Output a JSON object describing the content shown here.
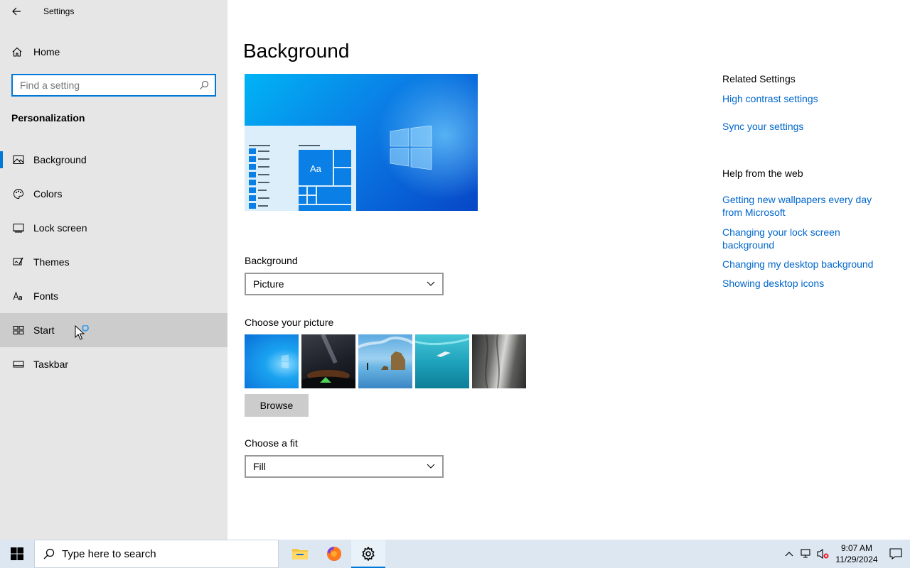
{
  "window": {
    "title": "Settings"
  },
  "sidebar": {
    "home_label": "Home",
    "search_placeholder": "Find a setting",
    "section_title": "Personalization",
    "items": [
      {
        "label": "Background",
        "icon": "picture-icon"
      },
      {
        "label": "Colors",
        "icon": "palette-icon"
      },
      {
        "label": "Lock screen",
        "icon": "lock-screen-icon"
      },
      {
        "label": "Themes",
        "icon": "themes-icon"
      },
      {
        "label": "Fonts",
        "icon": "fonts-icon"
      },
      {
        "label": "Start",
        "icon": "start-icon"
      },
      {
        "label": "Taskbar",
        "icon": "taskbar-icon"
      }
    ],
    "active_item": "Background",
    "hover_item": "Start"
  },
  "main": {
    "title": "Background",
    "preview_sample_text": "Aa",
    "background_label": "Background",
    "background_value": "Picture",
    "choose_picture_label": "Choose your picture",
    "browse_label": "Browse",
    "fit_label": "Choose a fit",
    "fit_value": "Fill"
  },
  "related": {
    "related_heading": "Related Settings",
    "links1": [
      "High contrast settings",
      "Sync your settings"
    ],
    "help_heading": "Help from the web",
    "links2": [
      "Getting new wallpapers every day from Microsoft",
      "Changing your lock screen background",
      "Changing my desktop background",
      "Showing desktop icons"
    ]
  },
  "taskbar": {
    "search_placeholder": "Type here to search",
    "time": "9:07 AM",
    "date": "11/29/2024"
  },
  "colors": {
    "accent": "#0078d7",
    "link": "#0066cc",
    "sidebar_bg": "#e6e6e6",
    "taskbar_bg": "#dde7f1"
  }
}
